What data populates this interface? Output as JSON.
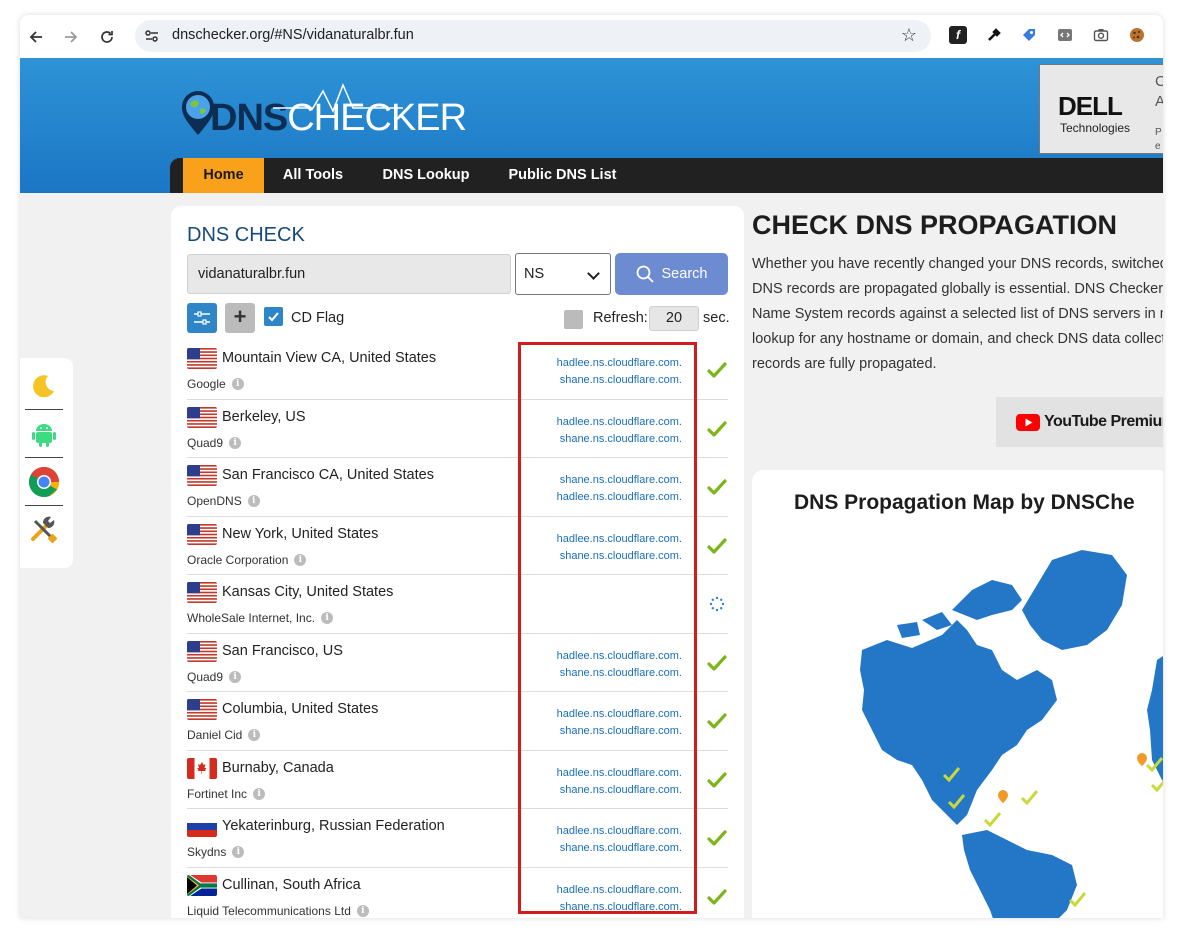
{
  "browser": {
    "url": "dnschecker.org/#NS/vidanaturalbr.fun"
  },
  "site": {
    "logo": {
      "dns": "DNS",
      "checker": "CHECKER"
    },
    "nav": [
      "Home",
      "All Tools",
      "DNS Lookup",
      "Public DNS List"
    ],
    "ad": {
      "brand": "DELL",
      "sub": "Technologies",
      "c": "C",
      "a": "A",
      "p": "P",
      "e": "e"
    }
  },
  "dns_check": {
    "title": "DNS CHECK",
    "domain": "vidanaturalbr.fun",
    "record_type": "NS",
    "search_label": "Search",
    "cd_flag_label": "CD Flag",
    "refresh_label": "Refresh:",
    "refresh_value": "20",
    "refresh_unit": "sec.",
    "results": [
      {
        "flag": "us",
        "location": "Mountain View CA, United States",
        "provider": "Google",
        "ns1": "hadlee.ns.cloudflare.com.",
        "ns2": "shane.ns.cloudflare.com.",
        "status": "ok"
      },
      {
        "flag": "us",
        "location": "Berkeley, US",
        "provider": "Quad9",
        "ns1": "hadlee.ns.cloudflare.com.",
        "ns2": "shane.ns.cloudflare.com.",
        "status": "ok"
      },
      {
        "flag": "us",
        "location": "San Francisco CA, United States",
        "provider": "OpenDNS",
        "ns1": "shane.ns.cloudflare.com.",
        "ns2": "hadlee.ns.cloudflare.com.",
        "status": "ok"
      },
      {
        "flag": "us",
        "location": "New York, United States",
        "provider": "Oracle Corporation",
        "ns1": "hadlee.ns.cloudflare.com.",
        "ns2": "shane.ns.cloudflare.com.",
        "status": "ok"
      },
      {
        "flag": "us",
        "location": "Kansas City, United States",
        "provider": "WholeSale Internet, Inc.",
        "ns1": "",
        "ns2": "",
        "status": "loading"
      },
      {
        "flag": "us",
        "location": "San Francisco, US",
        "provider": "Quad9",
        "ns1": "hadlee.ns.cloudflare.com.",
        "ns2": "shane.ns.cloudflare.com.",
        "status": "ok"
      },
      {
        "flag": "us",
        "location": "Columbia, United States",
        "provider": "Daniel Cid",
        "ns1": "hadlee.ns.cloudflare.com.",
        "ns2": "shane.ns.cloudflare.com.",
        "status": "ok"
      },
      {
        "flag": "ca",
        "location": "Burnaby, Canada",
        "provider": "Fortinet Inc",
        "ns1": "hadlee.ns.cloudflare.com.",
        "ns2": "shane.ns.cloudflare.com.",
        "status": "ok"
      },
      {
        "flag": "ru",
        "location": "Yekaterinburg, Russian Federation",
        "provider": "Skydns",
        "ns1": "hadlee.ns.cloudflare.com.",
        "ns2": "shane.ns.cloudflare.com.",
        "status": "ok"
      },
      {
        "flag": "za",
        "location": "Cullinan, South Africa",
        "provider": "Liquid Telecommunications Ltd",
        "ns1": "hadlee.ns.cloudflare.com.",
        "ns2": "shane.ns.cloudflare.com.",
        "status": "ok"
      }
    ]
  },
  "propagation": {
    "title": "CHECK DNS PROPAGATION",
    "description_lines": [
      "Whether you have recently changed your DNS records, switched w",
      "DNS records are propagated globally is essential. DNS Checker pro",
      "Name System records against a selected list of DNS servers in mul",
      "lookup for any hostname or domain, and check DNS data collected",
      "records are fully propagated."
    ],
    "yt_ad": "YouTube Premium",
    "map_title": "DNS Propagation Map by DNSChe"
  },
  "colors": {
    "accent": "#f9a11b",
    "header": "#1b76c4",
    "link": "#1a6fb8",
    "highlight": "#d01c1c",
    "check": "#7cb518"
  }
}
